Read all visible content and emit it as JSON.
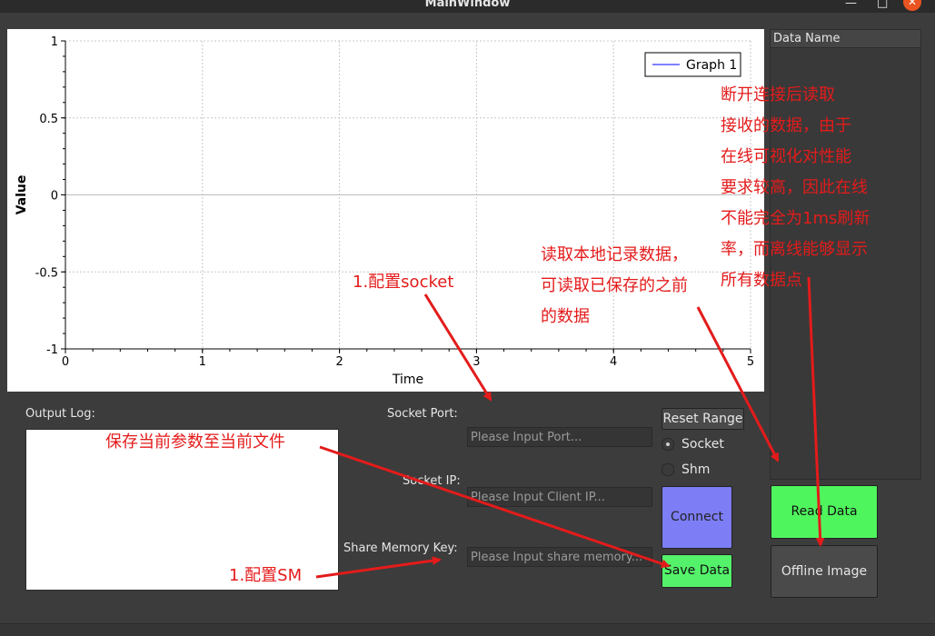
{
  "window": {
    "title": "MainWindow",
    "minimize": "—",
    "maximize": "□",
    "close": "✕"
  },
  "chart_data": {
    "type": "line",
    "x": [
      0,
      5
    ],
    "series": [
      {
        "name": "Graph 1",
        "values": [
          0,
          0
        ],
        "color": "#0000ff"
      }
    ],
    "xlabel": "Time",
    "ylabel": "Value",
    "xlim": [
      0,
      5
    ],
    "ylim": [
      -1,
      1
    ],
    "xticks": [
      "0",
      "1",
      "2",
      "3",
      "4",
      "5"
    ],
    "yticks": [
      "-1",
      "-0.5",
      "0",
      "0.5",
      "1"
    ],
    "grid": true,
    "legend": "top-right"
  },
  "data_list": {
    "header": "Data Name"
  },
  "output_log": {
    "label": "Output Log:"
  },
  "socket": {
    "port_label": "Socket Port:",
    "port_placeholder": "Please Input Port...",
    "ip_label": "Socket IP:",
    "ip_placeholder": "Please Input Client IP..."
  },
  "share_memory": {
    "label": "Share Memory Key:",
    "placeholder": "Please Input share memory..."
  },
  "buttons": {
    "reset_range": "Reset Range",
    "connect": "Connect",
    "save_data": "Save Data",
    "read_data": "Read Data",
    "offline_image": "Offline Image"
  },
  "mode": {
    "options": [
      "Socket",
      "Shm"
    ],
    "selected": "Socket"
  },
  "annotations": {
    "config_socket": "1.配置socket",
    "read_local": "读取本地记录数据，\n可读取已保存的之前\n的数据",
    "offline": "断开连接后读取\n接收的数据，由于\n在线可视化对性能\n要求较高，因此在线\n不能完全为1ms刷新\n率，而离线能够显示\n所有数据点",
    "save_params": "保存当前参数至当前文件",
    "config_sm": "1.配置SM",
    "color": "#e41b1b"
  }
}
